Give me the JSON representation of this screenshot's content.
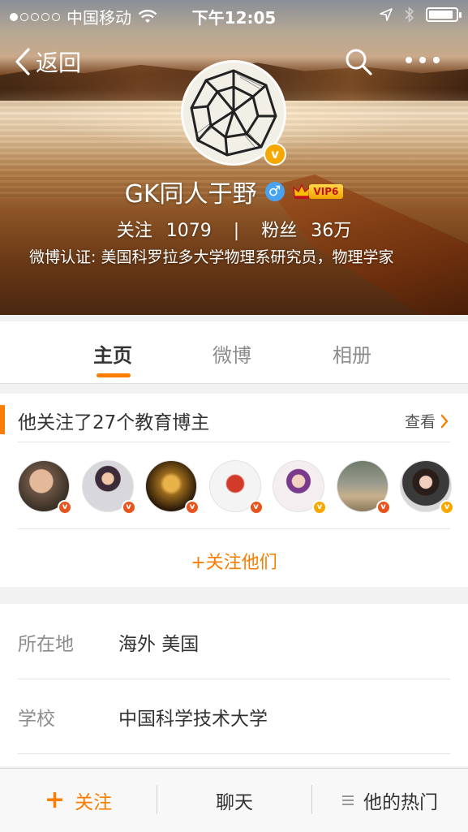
{
  "status_bar": {
    "carrier": "中国移动",
    "time": "下午12:05",
    "signal_bars_filled": 1,
    "signal_bars_total": 5,
    "battery_level": 0.9
  },
  "nav": {
    "back_label": "返回"
  },
  "profile": {
    "name": "GK同人于野",
    "gender_symbol": "♂",
    "vip_label": "VIP6",
    "verified_badge": "v",
    "following_label": "关注",
    "following_count": "1079",
    "stats_separator": "|",
    "followers_label": "粉丝",
    "followers_count": "36万",
    "verification": "微博认证: 美国科罗拉多大学物理系研究员，物理学家"
  },
  "tabs": [
    {
      "label": "主页",
      "active": true
    },
    {
      "label": "微博",
      "active": false
    },
    {
      "label": "相册",
      "active": false
    }
  ],
  "follow_card": {
    "title": "他关注了27个教育博主",
    "view_label": "查看",
    "follow_all_label": "+关注他们",
    "avatars": [
      {
        "badge": "v",
        "badge_color": "#e8541e"
      },
      {
        "badge": "v",
        "badge_color": "#e8541e"
      },
      {
        "badge": "v",
        "badge_color": "#e8541e"
      },
      {
        "badge": "v",
        "badge_color": "#e8541e"
      },
      {
        "badge": "v",
        "badge_color": "#f6a800"
      },
      {
        "badge": "v",
        "badge_color": "#e8541e"
      },
      {
        "badge": "v",
        "badge_color": "#f6a800"
      }
    ]
  },
  "info": {
    "location_label": "所在地",
    "location_value": "海外 美国",
    "school_label": "学校",
    "school_value": "中国科学技术大学"
  },
  "toolbar": {
    "follow_label": "关注",
    "follow_plus": "+",
    "chat_label": "聊天",
    "hot_label": "他的热门"
  },
  "colors": {
    "accent": "#fa7d00",
    "verified_gold": "#f6a800",
    "gender_blue": "#4aa3f0"
  }
}
